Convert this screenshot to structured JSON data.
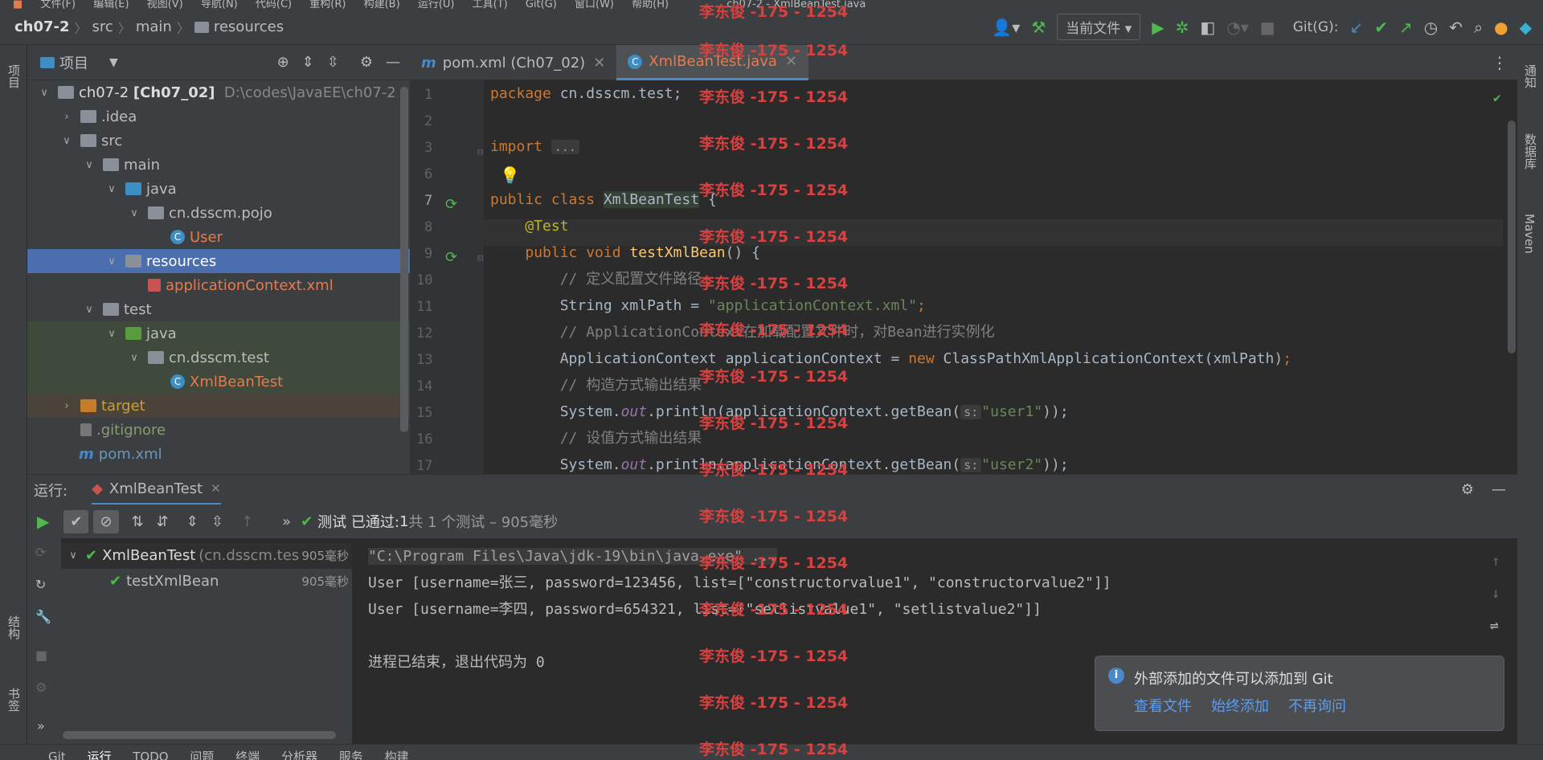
{
  "menubar": {
    "items": [
      "文件(F)",
      "编辑(E)",
      "视图(V)",
      "导航(N)",
      "代码(C)",
      "重构(R)",
      "构建(B)",
      "运行(U)",
      "工具(T)",
      "Git(G)",
      "窗口(W)",
      "帮助(H)"
    ],
    "title": "ch07-2 - XmlBeanTest.java"
  },
  "navbar": {
    "project": "ch07-2",
    "crumbs": [
      "src",
      "main",
      "resources"
    ],
    "run_config": "当前文件",
    "git_label": "Git(G):"
  },
  "left_strip": {
    "project": "项目",
    "structure": "结构",
    "bookmarks": "书签"
  },
  "right_strip": {
    "notifications": "通知",
    "database": "数据库",
    "maven": "Maven"
  },
  "project_panel": {
    "title": "项目"
  },
  "tree": [
    {
      "label": "ch07-2",
      "module": "[Ch07_02]",
      "path": "D:\\codes\\JavaEE\\ch07-2",
      "depth": 0,
      "chev": "v",
      "icon": "folder"
    },
    {
      "label": ".idea",
      "depth": 1,
      "chev": ">",
      "icon": "folder"
    },
    {
      "label": "src",
      "depth": 1,
      "chev": "v",
      "icon": "folder"
    },
    {
      "label": "main",
      "depth": 2,
      "chev": "v",
      "icon": "folder"
    },
    {
      "label": "java",
      "depth": 3,
      "chev": "v",
      "icon": "folder-blue"
    },
    {
      "label": "cn.dsscm.pojo",
      "depth": 4,
      "chev": "v",
      "icon": "folder"
    },
    {
      "label": "User",
      "depth": 5,
      "chev": "",
      "icon": "class"
    },
    {
      "label": "resources",
      "depth": 3,
      "chev": "v",
      "icon": "folder"
    },
    {
      "label": "applicationContext.xml",
      "depth": 4,
      "chev": "",
      "icon": "xml"
    },
    {
      "label": "test",
      "depth": 2,
      "chev": "v",
      "icon": "folder"
    },
    {
      "label": "java",
      "depth": 3,
      "chev": "v",
      "icon": "folder-green"
    },
    {
      "label": "cn.dsscm.test",
      "depth": 4,
      "chev": "v",
      "icon": "folder"
    },
    {
      "label": "XmlBeanTest",
      "depth": 5,
      "chev": "",
      "icon": "class"
    },
    {
      "label": "target",
      "depth": 1,
      "chev": ">",
      "icon": "folder-orange"
    },
    {
      "label": ".gitignore",
      "depth": 1,
      "chev": "",
      "icon": "file"
    },
    {
      "label": "pom.xml",
      "depth": 1,
      "chev": "",
      "icon": "maven"
    }
  ],
  "editor_tabs": [
    {
      "label": "pom.xml (Ch07_02)",
      "icon": "m"
    },
    {
      "label": "XmlBeanTest.java",
      "icon": "c"
    }
  ],
  "line_numbers": [
    "1",
    "2",
    "3",
    "6",
    "7",
    "8",
    "9",
    "10",
    "11",
    "12",
    "13",
    "14",
    "15",
    "16",
    "17"
  ],
  "code": {
    "l1a": "package",
    "l1b": " cn.dsscm.test;",
    "l3a": "import",
    "l3b": "...",
    "l7a": "public class",
    "l7b": "XmlBeanTest",
    "l7c": " {",
    "l8": "@Test",
    "l9a": "public void",
    "l9b": "testXmlBean",
    "l9c": "() {",
    "l10": "// 定义配置文件路径",
    "l11a": "String xmlPath = ",
    "l11b": "\"applicationContext.xml\"",
    "l11c": ";",
    "l12": "// ApplicationContext在加载配置文件时，对Bean进行实例化",
    "l13a": "ApplicationContext applicationContext = ",
    "l13b": "new",
    "l13c": " ClassPathXmlApplicationContext(xmlPath)",
    "l13d": ";",
    "l14": "// 构造方式输出结果",
    "l15a": "System.",
    "l15b": "out",
    "l15c": ".println(applicationContext.getBean(",
    "l15d": "s:",
    "l15e": "\"user1\"",
    "l15f": "));",
    "l16": "// 设值方式输出结果",
    "l17a": "System.",
    "l17b": "out",
    "l17c": ".println(applicationContext.getBean(",
    "l17d": "s:",
    "l17e": "\"user2\"",
    "l17f": "));"
  },
  "run": {
    "label": "运行:",
    "tab": "XmlBeanTest",
    "status_prefix": "测试 已通过:",
    "status_count": "1",
    "status_rest": "共 1 个测试 – 905毫秒",
    "tests": [
      {
        "name": "XmlBeanTest",
        "pkg": "(cn.dsscm.tes",
        "time": "905毫秒"
      },
      {
        "name": "testXmlBean",
        "pkg": "",
        "time": "905毫秒"
      }
    ],
    "console": [
      "\"C:\\Program Files\\Java\\jdk-19\\bin\\java.exe\" ...",
      "User [username=张三, password=123456, list=[\"constructorvalue1\", \"constructorvalue2\"]]",
      "User [username=李四, password=654321, list=[\"setlistvalue1\", \"setlistvalue2\"]]",
      "",
      "进程已结束，退出代码为 0"
    ]
  },
  "notification": {
    "text": "外部添加的文件可以添加到 Git",
    "actions": [
      "查看文件",
      "始终添加",
      "不再询问"
    ]
  },
  "statusbar": {
    "items": [
      "Git",
      "运行",
      "TODO",
      "问题",
      "终端",
      "分析器",
      "服务",
      "构建"
    ]
  },
  "watermark": "李东俊 -175 - 1254"
}
